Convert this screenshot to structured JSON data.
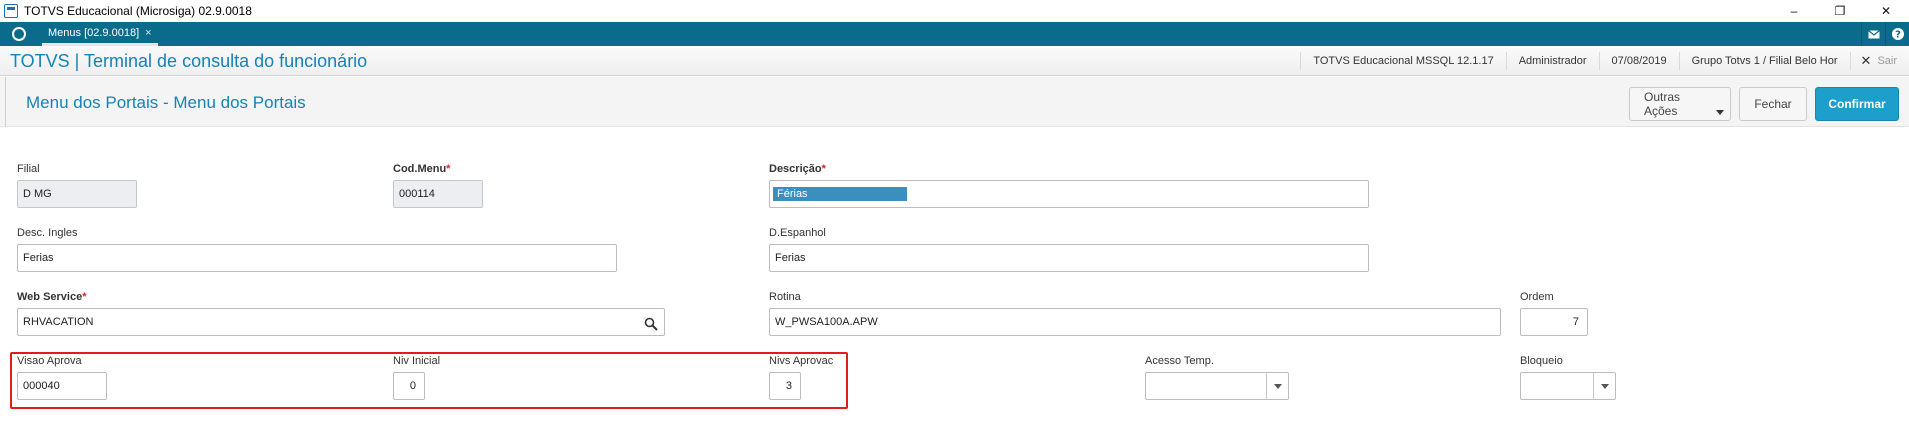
{
  "window": {
    "title": "TOTVS Educacional (Microsiga) 02.9.0018",
    "minimize": "–",
    "restore": "❐",
    "close": "✕"
  },
  "tabs": {
    "menu_tab_label": "Menus [02.9.0018]",
    "menu_tab_close": "×"
  },
  "header": {
    "title": "TOTVS | Terminal de consulta do funcionário",
    "status": [
      "TOTVS Educacional MSSQL 12.1.17",
      "Administrador",
      "07/08/2019",
      "Grupo Totvs 1 / Filial Belo Hor"
    ],
    "exit_label": "Sair"
  },
  "page": {
    "title": "Menu dos Portais - Menu dos Portais",
    "actions": {
      "other_actions": "Outras Ações",
      "close": "Fechar",
      "confirm": "Confirmar"
    }
  },
  "form": {
    "filial": {
      "label": "Filial",
      "value": "D MG"
    },
    "cod_menu": {
      "label": "Cod.Menu",
      "value": "000114"
    },
    "descricao": {
      "label": "Descrição",
      "value": "Férias"
    },
    "desc_ingles": {
      "label": "Desc. Ingles",
      "value": "Ferias"
    },
    "d_espanhol": {
      "label": "D.Espanhol",
      "value": "Ferias"
    },
    "web_service": {
      "label": "Web Service",
      "value": "RHVACATION"
    },
    "rotina": {
      "label": "Rotina",
      "value": "W_PWSA100A.APW"
    },
    "ordem": {
      "label": "Ordem",
      "value": "7"
    },
    "visao_aprova": {
      "label": "Visao Aprova",
      "value": "000040"
    },
    "niv_inicial": {
      "label": "Niv Inicial",
      "value": "0"
    },
    "nivs_aprovac": {
      "label": "Nivs Aprovac",
      "value": "3"
    },
    "acesso_temp": {
      "label": "Acesso Temp.",
      "value": ""
    },
    "bloqueio": {
      "label": "Bloqueio",
      "value": ""
    },
    "required_mark": "*"
  },
  "colors": {
    "accent": "#1483b7",
    "tabbar": "#0a6b8a",
    "confirm": "#1e9ecb",
    "highlight": "#e21b1b"
  }
}
